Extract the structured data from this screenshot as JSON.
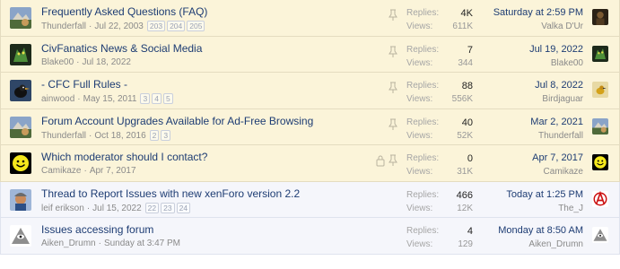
{
  "threads": [
    {
      "title": "Frequently Asked Questions (FAQ)",
      "author": "Thunderfall",
      "date": "Jul 22, 2003",
      "pages": [
        "203",
        "204",
        "205"
      ],
      "locked": false,
      "sticky": true,
      "replies_label": "Replies:",
      "replies": "4K",
      "views_label": "Views:",
      "views": "611K",
      "last_post": "Saturday at 2:59 PM",
      "last_poster": "Valka D'Ur",
      "avatar_icon": "civ-avatar-icon",
      "last_avatar_icon": "dark-portrait-icon"
    },
    {
      "title": "CivFanatics News & Social Media",
      "author": "Blake00",
      "date": "Jul 18, 2022",
      "pages": [],
      "locked": false,
      "sticky": true,
      "replies_label": "Replies:",
      "replies": "7",
      "views_label": "Views:",
      "views": "344",
      "last_post": "Jul 19, 2022",
      "last_poster": "Blake00",
      "avatar_icon": "green-creature-icon",
      "last_avatar_icon": "green-creature-icon"
    },
    {
      "title": "- CFC Full Rules -",
      "author": "ainwood",
      "date": "May 15, 2011",
      "pages": [
        "3",
        "4",
        "5"
      ],
      "locked": false,
      "sticky": true,
      "replies_label": "Replies:",
      "replies": "88",
      "views_label": "Views:",
      "views": "556K",
      "last_post": "Jul 8, 2022",
      "last_poster": "Birdjaguar",
      "avatar_icon": "bird-avatar-icon",
      "last_avatar_icon": "yellow-bird-icon"
    },
    {
      "title": "Forum Account Upgrades Available for Ad-Free Browsing",
      "author": "Thunderfall",
      "date": "Oct 18, 2016",
      "pages": [
        "2",
        "3"
      ],
      "locked": false,
      "sticky": true,
      "replies_label": "Replies:",
      "replies": "40",
      "views_label": "Views:",
      "views": "52K",
      "last_post": "Mar 2, 2021",
      "last_poster": "Thunderfall",
      "avatar_icon": "civ-avatar-icon",
      "last_avatar_icon": "civ-avatar-icon"
    },
    {
      "title": "Which moderator should I contact?",
      "author": "Camikaze",
      "date": "Apr 7, 2017",
      "pages": [],
      "locked": true,
      "sticky": true,
      "replies_label": "Replies:",
      "replies": "0",
      "views_label": "Views:",
      "views": "31K",
      "last_post": "Apr 7, 2017",
      "last_poster": "Camikaze",
      "avatar_icon": "smiley-icon",
      "last_avatar_icon": "smiley-icon"
    },
    {
      "title": "Thread to Report Issues with new xenForo version 2.2",
      "author": "leif erikson",
      "date": "Jul 15, 2022",
      "pages": [
        "22",
        "23",
        "24"
      ],
      "locked": false,
      "sticky": false,
      "replies_label": "Replies:",
      "replies": "466",
      "views_label": "Views:",
      "views": "12K",
      "last_post": "Today at 1:25 PM",
      "last_poster": "The_J",
      "avatar_icon": "viking-avatar-icon",
      "last_avatar_icon": "anarchy-symbol-icon"
    },
    {
      "title": "Issues accessing forum",
      "author": "Aiken_Drumn",
      "date": "Sunday at 3:47 PM",
      "pages": [],
      "locked": false,
      "sticky": false,
      "replies_label": "Replies:",
      "replies": "4",
      "views_label": "Views:",
      "views": "129",
      "last_post": "Monday at 8:50 AM",
      "last_poster": "Aiken_Drumn",
      "avatar_icon": "pyramid-eye-icon",
      "last_avatar_icon": "pyramid-eye-icon"
    }
  ],
  "colors": {
    "sticky_bg": "#fbf4d9",
    "normal_bg": "#f5f6fb",
    "title": "#1d3c73",
    "meta": "#8a8a8a"
  }
}
